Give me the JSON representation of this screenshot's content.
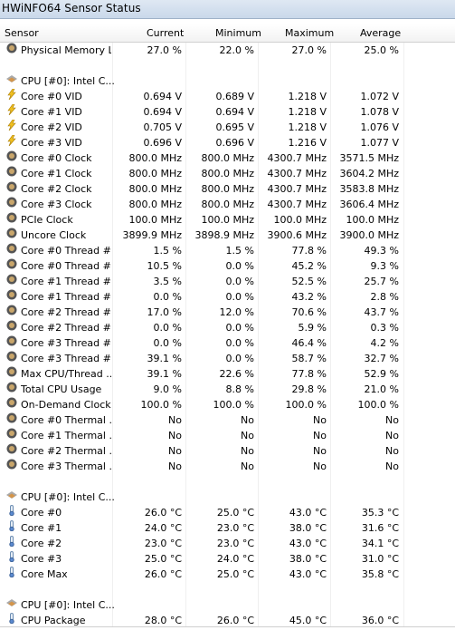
{
  "window": {
    "title": "HWiNFO64 Sensor Status"
  },
  "columns": [
    "Sensor",
    "Current",
    "Minimum",
    "Maximum",
    "Average"
  ],
  "rows": [
    {
      "type": "sensor",
      "icon": "memory-icon",
      "name": "Physical Memory L...",
      "current": "27.0 %",
      "minimum": "22.0 %",
      "maximum": "27.0 %",
      "average": "25.0 %"
    },
    {
      "type": "spacer"
    },
    {
      "type": "section",
      "icon": "cpu-icon",
      "name": "CPU [#0]: Intel C..."
    },
    {
      "type": "sensor",
      "icon": "voltage-icon",
      "name": "Core #0 VID",
      "current": "0.694 V",
      "minimum": "0.689 V",
      "maximum": "1.218 V",
      "average": "1.072 V"
    },
    {
      "type": "sensor",
      "icon": "voltage-icon",
      "name": "Core #1 VID",
      "current": "0.694 V",
      "minimum": "0.694 V",
      "maximum": "1.218 V",
      "average": "1.078 V"
    },
    {
      "type": "sensor",
      "icon": "voltage-icon",
      "name": "Core #2 VID",
      "current": "0.705 V",
      "minimum": "0.695 V",
      "maximum": "1.218 V",
      "average": "1.076 V"
    },
    {
      "type": "sensor",
      "icon": "voltage-icon",
      "name": "Core #3 VID",
      "current": "0.696 V",
      "minimum": "0.696 V",
      "maximum": "1.216 V",
      "average": "1.077 V"
    },
    {
      "type": "sensor",
      "icon": "clock-icon",
      "name": "Core #0 Clock",
      "current": "800.0 MHz",
      "minimum": "800.0 MHz",
      "maximum": "4300.7 MHz",
      "average": "3571.5 MHz"
    },
    {
      "type": "sensor",
      "icon": "clock-icon",
      "name": "Core #1 Clock",
      "current": "800.0 MHz",
      "minimum": "800.0 MHz",
      "maximum": "4300.7 MHz",
      "average": "3604.2 MHz"
    },
    {
      "type": "sensor",
      "icon": "clock-icon",
      "name": "Core #2 Clock",
      "current": "800.0 MHz",
      "minimum": "800.0 MHz",
      "maximum": "4300.7 MHz",
      "average": "3583.8 MHz"
    },
    {
      "type": "sensor",
      "icon": "clock-icon",
      "name": "Core #3 Clock",
      "current": "800.0 MHz",
      "minimum": "800.0 MHz",
      "maximum": "4300.7 MHz",
      "average": "3606.4 MHz"
    },
    {
      "type": "sensor",
      "icon": "clock-icon",
      "name": "PCIe Clock",
      "current": "100.0 MHz",
      "minimum": "100.0 MHz",
      "maximum": "100.0 MHz",
      "average": "100.0 MHz"
    },
    {
      "type": "sensor",
      "icon": "clock-icon",
      "name": "Uncore Clock",
      "current": "3899.9 MHz",
      "minimum": "3898.9 MHz",
      "maximum": "3900.6 MHz",
      "average": "3900.0 MHz"
    },
    {
      "type": "sensor",
      "icon": "usage-icon",
      "name": "Core #0 Thread #...",
      "current": "1.5 %",
      "minimum": "1.5 %",
      "maximum": "77.8 %",
      "average": "49.3 %"
    },
    {
      "type": "sensor",
      "icon": "usage-icon",
      "name": "Core #0 Thread #...",
      "current": "10.5 %",
      "minimum": "0.0 %",
      "maximum": "45.2 %",
      "average": "9.3 %"
    },
    {
      "type": "sensor",
      "icon": "usage-icon",
      "name": "Core #1 Thread #...",
      "current": "3.5 %",
      "minimum": "0.0 %",
      "maximum": "52.5 %",
      "average": "25.7 %"
    },
    {
      "type": "sensor",
      "icon": "usage-icon",
      "name": "Core #1 Thread #...",
      "current": "0.0 %",
      "minimum": "0.0 %",
      "maximum": "43.2 %",
      "average": "2.8 %"
    },
    {
      "type": "sensor",
      "icon": "usage-icon",
      "name": "Core #2 Thread #...",
      "current": "17.0 %",
      "minimum": "12.0 %",
      "maximum": "70.6 %",
      "average": "43.7 %"
    },
    {
      "type": "sensor",
      "icon": "usage-icon",
      "name": "Core #2 Thread #...",
      "current": "0.0 %",
      "minimum": "0.0 %",
      "maximum": "5.9 %",
      "average": "0.3 %"
    },
    {
      "type": "sensor",
      "icon": "usage-icon",
      "name": "Core #3 Thread #...",
      "current": "0.0 %",
      "minimum": "0.0 %",
      "maximum": "46.4 %",
      "average": "4.2 %"
    },
    {
      "type": "sensor",
      "icon": "usage-icon",
      "name": "Core #3 Thread #...",
      "current": "39.1 %",
      "minimum": "0.0 %",
      "maximum": "58.7 %",
      "average": "32.7 %"
    },
    {
      "type": "sensor",
      "icon": "usage-icon",
      "name": "Max CPU/Thread ...",
      "current": "39.1 %",
      "minimum": "22.6 %",
      "maximum": "77.8 %",
      "average": "52.9 %"
    },
    {
      "type": "sensor",
      "icon": "usage-icon",
      "name": "Total CPU Usage",
      "current": "9.0 %",
      "minimum": "8.8 %",
      "maximum": "29.8 %",
      "average": "21.0 %"
    },
    {
      "type": "sensor",
      "icon": "usage-icon",
      "name": "On-Demand Clock ...",
      "current": "100.0 %",
      "minimum": "100.0 %",
      "maximum": "100.0 %",
      "average": "100.0 %"
    },
    {
      "type": "sensor",
      "icon": "usage-icon",
      "name": "Core #0 Thermal ...",
      "current": "No",
      "minimum": "No",
      "maximum": "No",
      "average": "No"
    },
    {
      "type": "sensor",
      "icon": "usage-icon",
      "name": "Core #1 Thermal ...",
      "current": "No",
      "minimum": "No",
      "maximum": "No",
      "average": "No"
    },
    {
      "type": "sensor",
      "icon": "usage-icon",
      "name": "Core #2 Thermal ...",
      "current": "No",
      "minimum": "No",
      "maximum": "No",
      "average": "No"
    },
    {
      "type": "sensor",
      "icon": "usage-icon",
      "name": "Core #3 Thermal ...",
      "current": "No",
      "minimum": "No",
      "maximum": "No",
      "average": "No"
    },
    {
      "type": "spacer"
    },
    {
      "type": "section",
      "icon": "cpu-icon",
      "name": "CPU [#0]: Intel C..."
    },
    {
      "type": "sensor",
      "icon": "thermometer-icon",
      "name": "Core #0",
      "current": "26.0 °C",
      "minimum": "25.0 °C",
      "maximum": "43.0 °C",
      "average": "35.3 °C"
    },
    {
      "type": "sensor",
      "icon": "thermometer-icon",
      "name": "Core #1",
      "current": "24.0 °C",
      "minimum": "23.0 °C",
      "maximum": "38.0 °C",
      "average": "31.6 °C"
    },
    {
      "type": "sensor",
      "icon": "thermometer-icon",
      "name": "Core #2",
      "current": "23.0 °C",
      "minimum": "23.0 °C",
      "maximum": "43.0 °C",
      "average": "34.1 °C"
    },
    {
      "type": "sensor",
      "icon": "thermometer-icon",
      "name": "Core #3",
      "current": "25.0 °C",
      "minimum": "24.0 °C",
      "maximum": "38.0 °C",
      "average": "31.0 °C"
    },
    {
      "type": "sensor",
      "icon": "thermometer-icon",
      "name": "Core Max",
      "current": "26.0 °C",
      "minimum": "25.0 °C",
      "maximum": "43.0 °C",
      "average": "35.8 °C"
    },
    {
      "type": "spacer"
    },
    {
      "type": "section",
      "icon": "cpu-icon",
      "name": "CPU [#0]: Intel C..."
    },
    {
      "type": "sensor",
      "icon": "thermometer-icon",
      "name": "CPU Package",
      "current": "28.0 °C",
      "minimum": "26.0 °C",
      "maximum": "45.0 °C",
      "average": "36.0 °C"
    }
  ]
}
